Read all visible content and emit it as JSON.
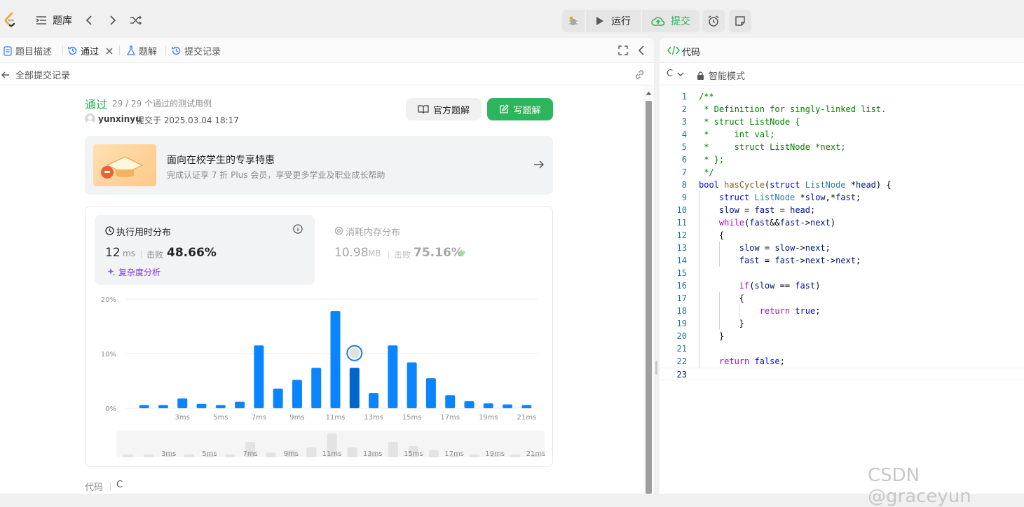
{
  "topbar": {
    "problem_list": "题库",
    "run": "运行",
    "submit": "提交"
  },
  "tabs": {
    "description": "题目描述",
    "passed": "通过",
    "solutions": "题解",
    "submissions": "提交记录"
  },
  "subnav": {
    "back": "全部提交记录"
  },
  "result": {
    "status": "通过",
    "cases": "29 / 29 个通过的测试用例",
    "user": "yunxinyu",
    "submitted_at": "提交于 2025.03.04 18:17",
    "official_solution": "官方题解",
    "write_solution": "写题解"
  },
  "promo": {
    "title": "面向在校学生的专享特惠",
    "desc": "完成认证享 7 折 Plus 会员，享受更多学业及职业成长帮助"
  },
  "runtime": {
    "title": "执行用时分布",
    "value": "12",
    "unit": "ms",
    "beats_label": "击败",
    "beats": "48.66%",
    "analysis": "复杂度分析"
  },
  "memory": {
    "title": "消耗内存分布",
    "value": "10.98",
    "unit": "MB",
    "beats_label": "击败",
    "beats": "75.16%"
  },
  "chart_data": {
    "type": "bar",
    "y_ticks": [
      "20%",
      "10%",
      "0%"
    ],
    "ylim": [
      0,
      20
    ],
    "categories": [
      "1ms",
      "2ms",
      "3ms",
      "4ms",
      "5ms",
      "6ms",
      "7ms",
      "8ms",
      "9ms",
      "10ms",
      "11ms",
      "12ms",
      "13ms",
      "14ms",
      "15ms",
      "16ms",
      "17ms",
      "18ms",
      "19ms",
      "20ms",
      "21ms"
    ],
    "x_tick_labels": [
      "3ms",
      "5ms",
      "7ms",
      "9ms",
      "11ms",
      "13ms",
      "15ms",
      "17ms",
      "19ms",
      "21ms"
    ],
    "values": [
      0.6,
      0.6,
      1.8,
      0.8,
      0.6,
      1.2,
      11.5,
      3.6,
      5.2,
      7.4,
      17.8,
      7.4,
      2.8,
      11.5,
      8.4,
      5.5,
      2.4,
      1.3,
      0.9,
      0.7,
      0.6
    ],
    "highlight_category": "12ms",
    "colors": {
      "bar": "#0a84ff",
      "highlight": "#0066cc",
      "mini_bar": "#e3e3e3"
    }
  },
  "bottom": {
    "code_label": "代码",
    "lang": "C"
  },
  "editor": {
    "title": "代码",
    "lang": "C",
    "mode": "智能模式",
    "lines": [
      [
        [
          "cm",
          "/**"
        ]
      ],
      [
        [
          "cm",
          " * Definition for singly-linked list."
        ]
      ],
      [
        [
          "cm",
          " * struct ListNode {"
        ]
      ],
      [
        [
          "cm",
          " *     int val;"
        ]
      ],
      [
        [
          "cm",
          " *     struct ListNode *next;"
        ]
      ],
      [
        [
          "cm",
          " * };"
        ]
      ],
      [
        [
          "cm",
          " */"
        ]
      ],
      [
        [
          "kw",
          "bool "
        ],
        [
          "fn",
          "hasCycle"
        ],
        [
          "pl",
          "("
        ],
        [
          "kw",
          "struct "
        ],
        [
          "ty",
          "ListNode "
        ],
        [
          "pl",
          "*"
        ],
        [
          "id",
          "head"
        ],
        [
          "pl",
          ") {"
        ]
      ],
      [
        [
          "pl",
          "    "
        ],
        [
          "kw",
          "struct "
        ],
        [
          "ty",
          "ListNode "
        ],
        [
          "pl",
          "*"
        ],
        [
          "id",
          "slow"
        ],
        [
          "pl",
          ",*"
        ],
        [
          "id",
          "fast"
        ],
        [
          "pl",
          ";"
        ]
      ],
      [
        [
          "pl",
          "    "
        ],
        [
          "id",
          "slow"
        ],
        [
          "pl",
          " = "
        ],
        [
          "id",
          "fast"
        ],
        [
          "pl",
          " = "
        ],
        [
          "id",
          "head"
        ],
        [
          "pl",
          ";"
        ]
      ],
      [
        [
          "pl",
          "    "
        ],
        [
          "ctl",
          "while"
        ],
        [
          "pl",
          "("
        ],
        [
          "id",
          "fast"
        ],
        [
          "pl",
          "&&"
        ],
        [
          "id",
          "fast"
        ],
        [
          "pl",
          "->"
        ],
        [
          "id",
          "next"
        ],
        [
          "pl",
          ")"
        ]
      ],
      [
        [
          "pl",
          "    {"
        ]
      ],
      [
        [
          "pl",
          "        "
        ],
        [
          "id",
          "slow"
        ],
        [
          "pl",
          " = "
        ],
        [
          "id",
          "slow"
        ],
        [
          "pl",
          "->"
        ],
        [
          "id",
          "next"
        ],
        [
          "pl",
          ";"
        ]
      ],
      [
        [
          "pl",
          "        "
        ],
        [
          "id",
          "fast"
        ],
        [
          "pl",
          " = "
        ],
        [
          "id",
          "fast"
        ],
        [
          "pl",
          "->"
        ],
        [
          "id",
          "next"
        ],
        [
          "pl",
          "->"
        ],
        [
          "id",
          "next"
        ],
        [
          "pl",
          ";"
        ]
      ],
      [
        [
          "pl",
          ""
        ]
      ],
      [
        [
          "pl",
          "        "
        ],
        [
          "ctl",
          "if"
        ],
        [
          "pl",
          "("
        ],
        [
          "id",
          "slow"
        ],
        [
          "pl",
          " == "
        ],
        [
          "id",
          "fast"
        ],
        [
          "pl",
          ")"
        ]
      ],
      [
        [
          "pl",
          "        {"
        ]
      ],
      [
        [
          "pl",
          "            "
        ],
        [
          "ctl",
          "return "
        ],
        [
          "kw",
          "true"
        ],
        [
          "pl",
          ";"
        ]
      ],
      [
        [
          "pl",
          "        }"
        ]
      ],
      [
        [
          "pl",
          "    }"
        ]
      ],
      [
        [
          "pl",
          ""
        ]
      ],
      [
        [
          "pl",
          "    "
        ],
        [
          "ctl",
          "return "
        ],
        [
          "kw",
          "false"
        ],
        [
          "pl",
          ";"
        ]
      ],
      [
        [
          "pl",
          ""
        ]
      ]
    ]
  },
  "watermark": "CSDN @graceyun"
}
